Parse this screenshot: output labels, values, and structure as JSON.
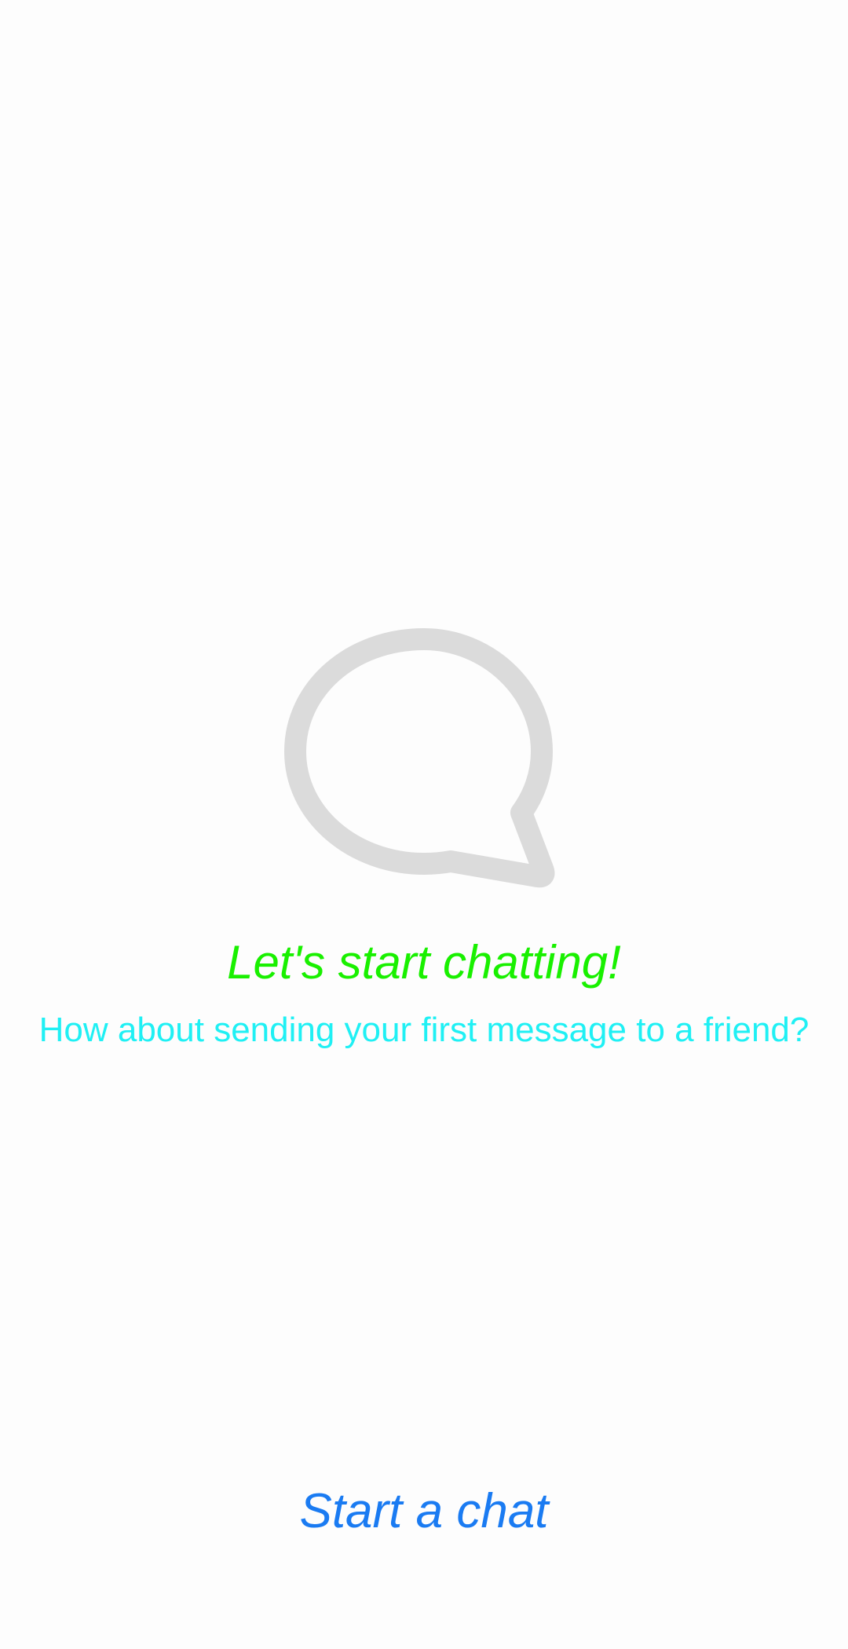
{
  "empty_state": {
    "icon": "speech-bubble-icon",
    "icon_color": "#dbdbdb",
    "title": "Let's start chatting!",
    "title_color": "#19f000",
    "subtitle": "How about sending your first message to a friend?",
    "subtitle_color": "#1ff0f4"
  },
  "actions": {
    "start_chat_label": "Start a chat",
    "start_chat_color": "#1a7bf2"
  },
  "background_color": "#fdfdfd"
}
